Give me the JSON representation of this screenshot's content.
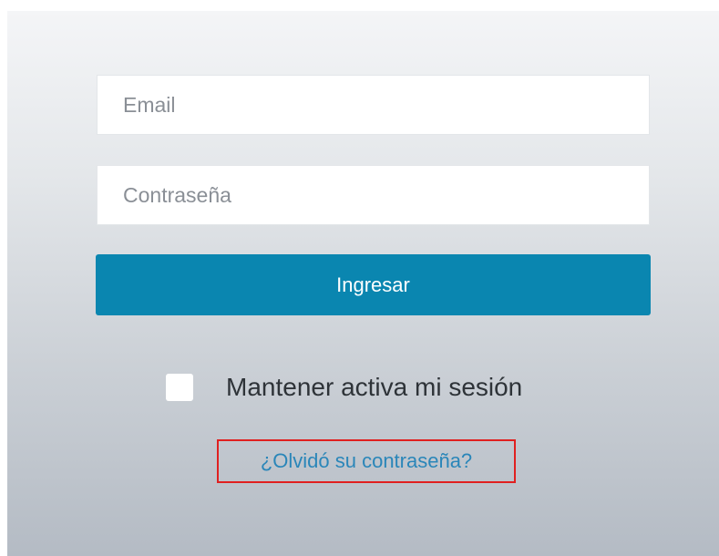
{
  "login": {
    "email_placeholder": "Email",
    "password_placeholder": "Contraseña",
    "submit_label": "Ingresar",
    "remember_label": "Mantener activa mi sesión",
    "forgot_label": "¿Olvidó su contraseña?"
  },
  "colors": {
    "button": "#0a86b0",
    "link": "#2a86b9",
    "highlight_box": "#e02020"
  }
}
